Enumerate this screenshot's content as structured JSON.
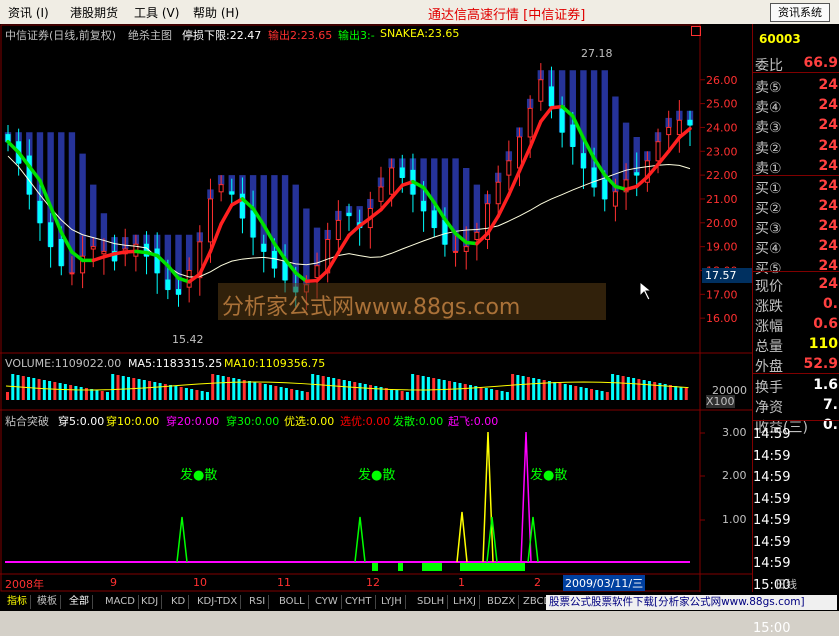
{
  "menu": {
    "items": [
      "资讯 (I)",
      "港股期货",
      "工具 (V)",
      "帮助 (H)"
    ],
    "app_title": "通达信高速行情 [中信证券]",
    "info_button": "资讯系统"
  },
  "main_chart": {
    "title": "中信证券(日线,前复权)",
    "indicator": "绝杀主图",
    "stop_loss": "停损下限:22.47",
    "output2": "输出2:23.65",
    "output3": "输出3:-",
    "snakea": "SNAKEA:23.65",
    "high_label": "27.18",
    "low_label": "15.42",
    "price_box": "17.57",
    "y_ticks": [
      "26.00",
      "25.00",
      "24.00",
      "23.00",
      "22.00",
      "21.00",
      "20.00",
      "19.00",
      "18.00",
      "17.00",
      "16.00"
    ],
    "watermark": "分析家公式网www.88gs.com"
  },
  "volume_panel": {
    "label": "VOLUME:1109022.00",
    "ma5": "MA5:1183315.25",
    "ma10": "MA10:1109356.75",
    "y_tick": "20000",
    "unit": "X100"
  },
  "signal_panel": {
    "title": "粘合突破",
    "items": [
      "穿5:0.00",
      "穿10:0.00",
      "穿20:0.00",
      "穿30:0.00",
      "优选:0.00",
      "选优:0.00",
      "发散:0.00",
      "起飞:0.00"
    ],
    "item_colors": [
      "#ffffff",
      "#ffff00",
      "#ff00ff",
      "#00ff00",
      "#ffff00",
      "#ff0000",
      "#00ff00",
      "#ff00ff"
    ],
    "y_ticks": [
      "3.00",
      "2.00",
      "1.00"
    ],
    "markers": [
      "发●散",
      "发●散",
      "发●散"
    ]
  },
  "x_axis": {
    "labels": [
      "2008年",
      "9",
      "10",
      "11",
      "12",
      "1",
      "2"
    ],
    "selected_date": "2009/03/11/三"
  },
  "side": {
    "code": "60003",
    "rows": [
      {
        "label": "委比",
        "value": "66.9",
        "color": "#ff4040"
      },
      {
        "label": "卖⑤",
        "value": "24",
        "color": "#ff4040"
      },
      {
        "label": "卖④",
        "value": "24",
        "color": "#ff4040"
      },
      {
        "label": "卖③",
        "value": "24",
        "color": "#ff4040"
      },
      {
        "label": "卖②",
        "value": "24",
        "color": "#ff4040"
      },
      {
        "label": "卖①",
        "value": "24",
        "color": "#ff4040"
      },
      {
        "label": "买①",
        "value": "24",
        "color": "#ff4040"
      },
      {
        "label": "买②",
        "value": "24",
        "color": "#ff4040"
      },
      {
        "label": "买③",
        "value": "24",
        "color": "#ff4040"
      },
      {
        "label": "买④",
        "value": "24",
        "color": "#ff4040"
      },
      {
        "label": "买⑤",
        "value": "24",
        "color": "#ff4040"
      },
      {
        "label": "现价",
        "value": "24",
        "color": "#ff4040"
      },
      {
        "label": "涨跌",
        "value": "0.",
        "color": "#ff4040"
      },
      {
        "label": "涨幅",
        "value": "0.6",
        "color": "#ff4040"
      },
      {
        "label": "总量",
        "value": "110",
        "color": "#ffff00"
      },
      {
        "label": "外盘",
        "value": "52.9",
        "color": "#ff4040"
      },
      {
        "label": "换手",
        "value": "1.6",
        "color": "#ffffff"
      },
      {
        "label": "净资",
        "value": "7.",
        "color": "#ffffff"
      },
      {
        "label": "收益(三)",
        "value": "0.",
        "color": "#ffffff"
      }
    ],
    "times": [
      "14:59",
      "14:59",
      "14:59",
      "14:59",
      "14:59",
      "14:59",
      "14:59",
      "15:00",
      "15:00",
      "15:00"
    ],
    "footer": "日线"
  },
  "tabs": [
    "指标",
    "模板",
    "全部",
    "MACD",
    "KDJ",
    "KD",
    "KDJ-TDX",
    "RSI",
    "BOLL",
    "CYW",
    "CYHT",
    "LYJH",
    "SDLH",
    "LHXJ",
    "BDZX",
    "ZBCD",
    "CJDX",
    "SI"
  ],
  "promo": "股票公式股票软件下载[分析家公式网www.88gs.com]",
  "chart_data": {
    "type": "candlestick",
    "ylim": [
      15,
      27.5
    ],
    "close_series": [
      23.4,
      22.5,
      21.2,
      20.0,
      19.0,
      18.2,
      17.9,
      18.6,
      19.0,
      18.8,
      18.4,
      18.9,
      19.1,
      18.6,
      17.9,
      17.2,
      17.0,
      18.0,
      19.2,
      21.0,
      21.6,
      21.2,
      20.2,
      19.4,
      18.8,
      18.1,
      17.6,
      17.1,
      17.4,
      18.2,
      19.3,
      20.1,
      20.3,
      19.8,
      20.6,
      21.5,
      22.3,
      21.9,
      21.2,
      20.5,
      19.8,
      19.1,
      18.8,
      19.0,
      19.6,
      20.8,
      21.7,
      22.6,
      23.6,
      24.8,
      26.0,
      24.9,
      23.8,
      23.2,
      22.3,
      21.5,
      21.0,
      21.3,
      21.8,
      22.0,
      22.6,
      23.4,
      24.0,
      24.3,
      24.1
    ]
  }
}
